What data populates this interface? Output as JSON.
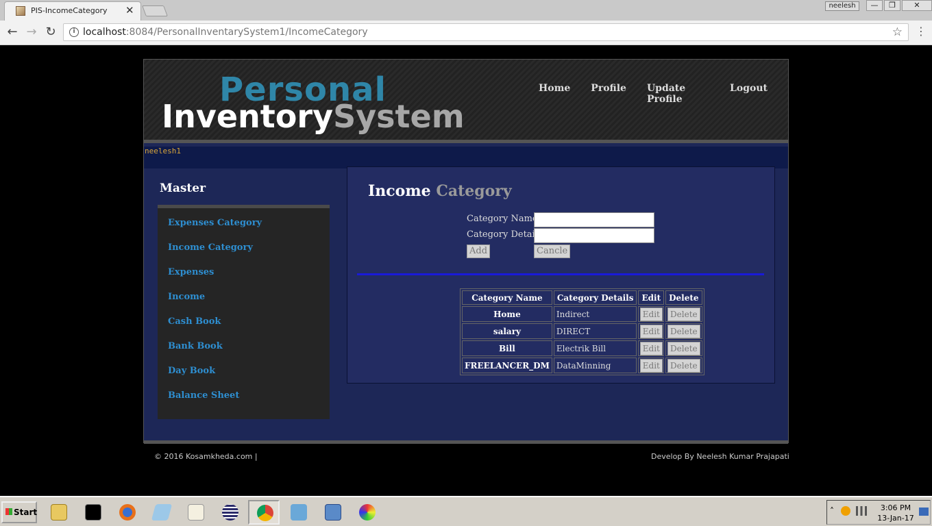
{
  "browser": {
    "tab_title": "PIS-IncomeCategory",
    "tab_close": "✕",
    "user_badge": "neelesh",
    "min": "—",
    "restore": "❐",
    "close": "✕",
    "back": "←",
    "forward": "→",
    "reload": "↻",
    "url_host": "localhost",
    "url_rest": ":8084/PersonalInventarySystem1/IncomeCategory",
    "star": "☆",
    "menu": "⋮"
  },
  "header": {
    "logo_top": "Personal",
    "logo_white": "Inventory",
    "logo_gray": "System",
    "nav": [
      "Home",
      "Profile",
      "Update Profile",
      "Logout"
    ]
  },
  "username": "neelesh1",
  "sidebar": {
    "title": "Master",
    "items": [
      "Expenses Category",
      "Income Category",
      "Expenses",
      "Income",
      "Cash Book",
      "Bank Book",
      "Day Book",
      "Balance Sheet"
    ]
  },
  "content": {
    "title_white": "Income",
    "title_gray": "Category",
    "form": {
      "name_label": "Category Name",
      "details_label": "Category Details",
      "name_value": "",
      "details_value": "",
      "add_label": "Add",
      "cancel_label": "Cancle"
    },
    "table": {
      "headers": [
        "Category Name",
        "Category Details",
        "Edit",
        "Delete"
      ],
      "rows": [
        {
          "name": "Home",
          "details": "Indirect"
        },
        {
          "name": "salary",
          "details": "DIRECT"
        },
        {
          "name": "Bill",
          "details": "Electrik Bill"
        },
        {
          "name": "FREELANCER_DM",
          "details": "DataMinning"
        }
      ],
      "edit_label": "Edit",
      "delete_label": "Delete"
    }
  },
  "footer": {
    "left": "© 2016 Kosamkheda.com |",
    "right": "Develop By Neelesh Kumar Prajapati"
  },
  "taskbar": {
    "start": "Start",
    "icons": [
      "file-manager-icon",
      "command-prompt-icon",
      "firefox-icon",
      "notepad-icon",
      "editor-icon",
      "eclipse-icon",
      "chrome-icon",
      "flash-icon",
      "virtualbox-icon",
      "paint-icon"
    ],
    "time": "3:06 PM",
    "date": "13-Jan-17"
  }
}
